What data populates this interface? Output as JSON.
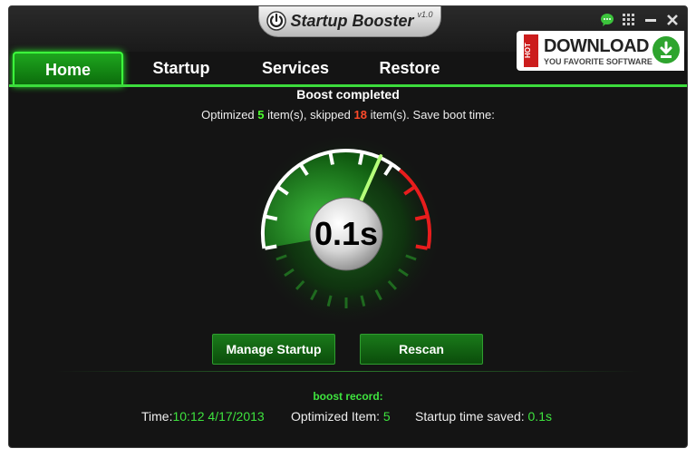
{
  "app": {
    "title": "Startup Booster",
    "version": "v1.0"
  },
  "tabs": [
    {
      "label": "Home",
      "active": true
    },
    {
      "label": "Startup",
      "active": false
    },
    {
      "label": "Services",
      "active": false
    },
    {
      "label": "Restore",
      "active": false
    }
  ],
  "ad": {
    "badge": "HOT",
    "title": "DOWNLOAD",
    "subtitle": "YOU FAVORITE SOFTWARE"
  },
  "status": {
    "title": "Boost completed",
    "prefix": "Optimized ",
    "optimized": "5",
    "middle": " item(s), skipped ",
    "skipped": "18",
    "suffix": " item(s). Save boot time:"
  },
  "gauge": {
    "value": "0.1s",
    "level": 0.62
  },
  "buttons": {
    "manage": "Manage Startup",
    "rescan": "Rescan"
  },
  "record": {
    "title": "boost record:",
    "time_label": "Time:",
    "time_value": "10:12 4/17/2013",
    "optimized_label": "Optimized Item: ",
    "optimized_value": "5",
    "saved_label": "Startup time saved: ",
    "saved_value": "0.1s"
  },
  "colors": {
    "accent": "#3cdc3c",
    "danger": "#e81d1d",
    "background": "#141414"
  },
  "icons": {
    "power": "power-icon",
    "chat": "chat-icon",
    "grid": "grid-icon",
    "minimize": "minimize-icon",
    "close": "close-icon",
    "download": "download-icon"
  }
}
